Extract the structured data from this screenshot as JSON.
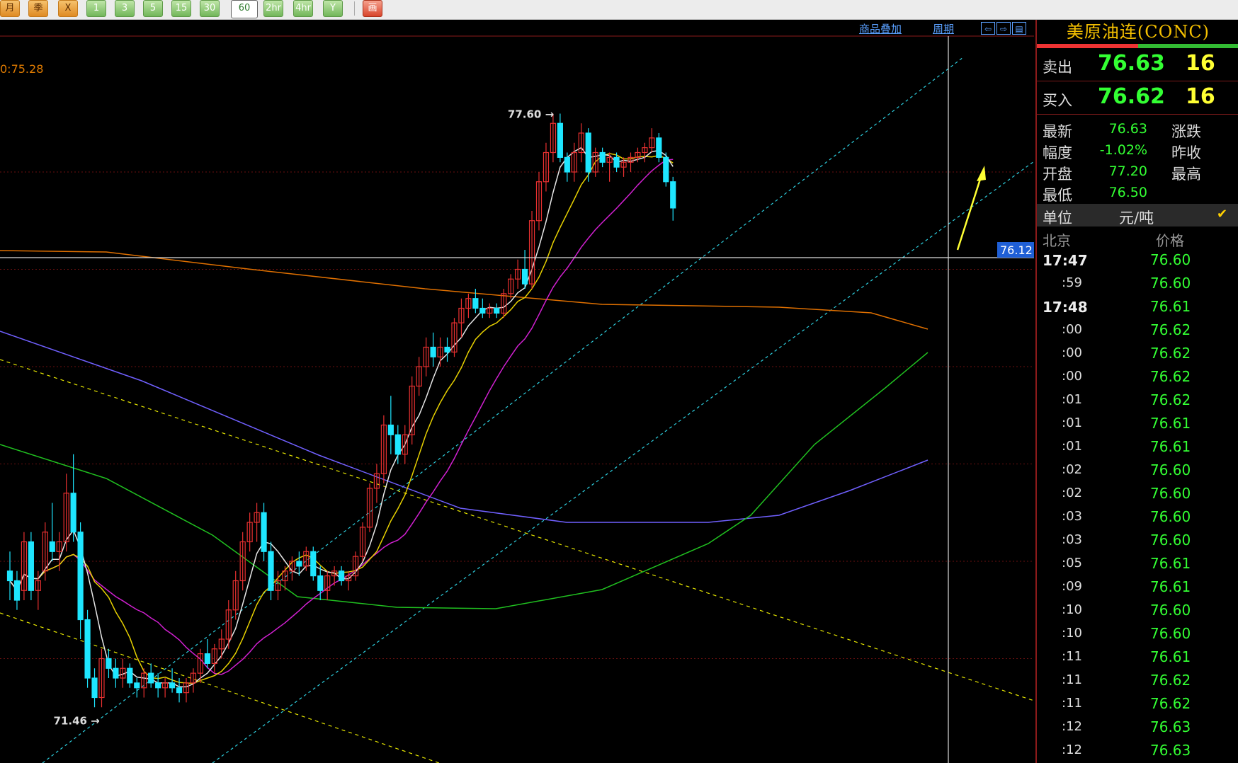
{
  "toolbar": {
    "buttons": [
      {
        "label": "月",
        "style": "orange"
      },
      {
        "label": "季",
        "style": "orange"
      },
      {
        "label": "X",
        "style": "orange"
      },
      {
        "label": "1",
        "style": "green"
      },
      {
        "label": "3",
        "style": "green"
      },
      {
        "label": "5",
        "style": "green"
      },
      {
        "label": "15",
        "style": "green"
      },
      {
        "label": "30",
        "style": "green"
      },
      {
        "label": "60",
        "style": "selected"
      },
      {
        "label": "2hr",
        "style": "green"
      },
      {
        "label": "4hr",
        "style": "green"
      },
      {
        "label": "Y",
        "style": "green"
      },
      {
        "label": "画",
        "style": "red"
      }
    ]
  },
  "chart_header": {
    "overlay_link": "商品叠加",
    "period_link": "周期",
    "ma_value": "0:75.28",
    "nav_icons": [
      "scroll-left-icon",
      "scroll-right-icon",
      "layout-icon"
    ]
  },
  "chart_data": {
    "type": "candlestick",
    "high_label": "77.60",
    "low_label": "71.46",
    "crosshair_price": "76.12",
    "colors": {
      "up": "#e83030",
      "down": "#1ee6ff",
      "ma5": "#e6e6e6",
      "ma10": "#e6d000",
      "ma20": "#d020d0",
      "ma60": "#20c020",
      "ma120": "#7060ff",
      "ma250": "#e07000",
      "channel": "#2ed0e0",
      "downtrend": "#e6e600",
      "arrow": "#ffff33"
    },
    "price_range": [
      71.0,
      78.2
    ],
    "candles": [
      [
        72.9,
        73.1,
        72.6,
        72.8
      ],
      [
        72.8,
        72.9,
        72.5,
        72.6
      ],
      [
        72.7,
        73.3,
        72.6,
        73.2
      ],
      [
        73.2,
        73.3,
        72.6,
        72.7
      ],
      [
        72.7,
        72.9,
        72.5,
        72.8
      ],
      [
        72.9,
        73.4,
        72.8,
        73.3
      ],
      [
        73.2,
        73.6,
        73.0,
        73.1
      ],
      [
        73.1,
        73.3,
        72.9,
        73.2
      ],
      [
        73.2,
        73.9,
        73.1,
        73.7
      ],
      [
        73.7,
        74.1,
        73.2,
        73.3
      ],
      [
        73.3,
        73.4,
        72.2,
        72.4
      ],
      [
        72.4,
        72.5,
        71.7,
        71.8
      ],
      [
        71.8,
        71.9,
        71.5,
        71.6
      ],
      [
        71.6,
        72.1,
        71.5,
        72.0
      ],
      [
        72.0,
        72.1,
        71.8,
        71.9
      ],
      [
        71.9,
        72.0,
        71.7,
        71.8
      ],
      [
        71.8,
        72.0,
        71.7,
        71.9
      ],
      [
        71.9,
        71.95,
        71.7,
        71.75
      ],
      [
        71.75,
        71.8,
        71.6,
        71.7
      ],
      [
        71.7,
        71.9,
        71.6,
        71.85
      ],
      [
        71.85,
        71.95,
        71.7,
        71.75
      ],
      [
        71.75,
        71.85,
        71.6,
        71.7
      ],
      [
        71.7,
        71.8,
        71.6,
        71.75
      ],
      [
        71.75,
        71.9,
        71.65,
        71.7
      ],
      [
        71.7,
        71.8,
        71.55,
        71.65
      ],
      [
        71.65,
        71.8,
        71.55,
        71.75
      ],
      [
        71.75,
        71.9,
        71.65,
        71.85
      ],
      [
        71.85,
        72.1,
        71.75,
        72.05
      ],
      [
        72.05,
        72.2,
        71.9,
        71.95
      ],
      [
        71.95,
        72.15,
        71.85,
        72.1
      ],
      [
        72.1,
        72.3,
        72.0,
        72.2
      ],
      [
        72.2,
        72.6,
        72.1,
        72.5
      ],
      [
        72.5,
        72.9,
        72.4,
        72.8
      ],
      [
        72.8,
        73.3,
        72.7,
        73.2
      ],
      [
        73.2,
        73.5,
        73.1,
        73.4
      ],
      [
        73.4,
        73.6,
        73.2,
        73.5
      ],
      [
        73.5,
        73.6,
        73.0,
        73.1
      ],
      [
        73.1,
        73.2,
        72.6,
        72.7
      ],
      [
        72.7,
        72.9,
        72.6,
        72.8
      ],
      [
        72.8,
        72.95,
        72.7,
        72.9
      ],
      [
        72.9,
        73.05,
        72.8,
        73.0
      ],
      [
        73.0,
        73.1,
        72.85,
        72.95
      ],
      [
        72.95,
        73.15,
        72.9,
        73.1
      ],
      [
        73.1,
        73.15,
        72.8,
        72.85
      ],
      [
        72.85,
        72.95,
        72.6,
        72.7
      ],
      [
        72.7,
        72.9,
        72.6,
        72.85
      ],
      [
        72.85,
        72.95,
        72.75,
        72.9
      ],
      [
        72.9,
        72.95,
        72.75,
        72.8
      ],
      [
        72.8,
        72.9,
        72.7,
        72.85
      ],
      [
        72.85,
        73.1,
        72.8,
        73.05
      ],
      [
        73.05,
        73.4,
        73.0,
        73.35
      ],
      [
        73.35,
        73.8,
        73.3,
        73.75
      ],
      [
        73.75,
        74.0,
        73.6,
        73.9
      ],
      [
        73.9,
        74.5,
        73.8,
        74.4
      ],
      [
        74.4,
        74.7,
        74.1,
        74.3
      ],
      [
        74.3,
        74.4,
        74.0,
        74.1
      ],
      [
        74.1,
        74.4,
        74.0,
        74.3
      ],
      [
        74.3,
        74.9,
        74.2,
        74.8
      ],
      [
        74.8,
        75.1,
        74.7,
        75.0
      ],
      [
        75.0,
        75.3,
        74.9,
        75.2
      ],
      [
        75.2,
        75.35,
        75.0,
        75.1
      ],
      [
        75.1,
        75.3,
        75.0,
        75.2
      ],
      [
        75.2,
        75.3,
        75.05,
        75.15
      ],
      [
        75.15,
        75.5,
        75.1,
        75.45
      ],
      [
        75.45,
        75.7,
        75.3,
        75.6
      ],
      [
        75.6,
        75.75,
        75.5,
        75.7
      ],
      [
        75.7,
        75.8,
        75.55,
        75.6
      ],
      [
        75.6,
        75.7,
        75.5,
        75.55
      ],
      [
        75.55,
        75.65,
        75.5,
        75.6
      ],
      [
        75.6,
        75.65,
        75.5,
        75.55
      ],
      [
        75.55,
        75.8,
        75.5,
        75.75
      ],
      [
        75.75,
        75.95,
        75.7,
        75.9
      ],
      [
        75.9,
        76.1,
        75.8,
        76.0
      ],
      [
        76.0,
        76.2,
        75.8,
        75.85
      ],
      [
        75.85,
        76.6,
        75.8,
        76.5
      ],
      [
        76.5,
        77.0,
        76.4,
        76.9
      ],
      [
        76.9,
        77.3,
        76.8,
        77.2
      ],
      [
        77.2,
        77.6,
        77.1,
        77.5
      ],
      [
        77.5,
        77.6,
        77.1,
        77.15
      ],
      [
        77.15,
        77.2,
        76.9,
        77.0
      ],
      [
        77.0,
        77.3,
        76.9,
        77.2
      ],
      [
        77.2,
        77.5,
        77.1,
        77.4
      ],
      [
        77.4,
        77.45,
        76.9,
        77.0
      ],
      [
        77.0,
        77.25,
        76.95,
        77.2
      ],
      [
        77.2,
        77.25,
        77.05,
        77.1
      ],
      [
        77.1,
        77.2,
        76.9,
        77.15
      ],
      [
        77.15,
        77.2,
        77.0,
        77.05
      ],
      [
        77.05,
        77.15,
        76.95,
        77.1
      ],
      [
        77.1,
        77.2,
        77.0,
        77.15
      ],
      [
        77.15,
        77.25,
        77.1,
        77.2
      ],
      [
        77.2,
        77.3,
        77.1,
        77.25
      ],
      [
        77.25,
        77.45,
        77.2,
        77.35
      ],
      [
        77.35,
        77.4,
        77.1,
        77.15
      ],
      [
        77.15,
        77.2,
        76.85,
        76.9
      ],
      [
        76.9,
        76.95,
        76.5,
        76.63
      ]
    ]
  },
  "panel": {
    "title": "美原油连(CONC)",
    "sell": {
      "label": "卖出",
      "price": "76.63",
      "volume": "16"
    },
    "buy": {
      "label": "买入",
      "price": "76.62",
      "volume": "16"
    },
    "info": [
      {
        "label": "最新",
        "value": "76.63",
        "label2": "涨跌"
      },
      {
        "label": "幅度",
        "value": "-1.02%",
        "label2": "昨收"
      },
      {
        "label": "开盘",
        "value": "77.20",
        "label2": "最高"
      },
      {
        "label": "最低",
        "value": "76.50",
        "label2": ""
      }
    ],
    "unit_label": "单位",
    "unit_value": "元/吨",
    "tick_header": {
      "time": "北京",
      "price": "价格"
    },
    "ticks": [
      {
        "time": "17:47",
        "price": "76.60",
        "main": true
      },
      {
        "time": ":59",
        "price": "76.60"
      },
      {
        "time": "17:48",
        "price": "76.61",
        "main": true
      },
      {
        "time": ":00",
        "price": "76.62"
      },
      {
        "time": ":00",
        "price": "76.62"
      },
      {
        "time": ":00",
        "price": "76.62"
      },
      {
        "time": ":01",
        "price": "76.62"
      },
      {
        "time": ":01",
        "price": "76.61"
      },
      {
        "time": ":01",
        "price": "76.61"
      },
      {
        "time": ":02",
        "price": "76.60"
      },
      {
        "time": ":02",
        "price": "76.60"
      },
      {
        "time": ":03",
        "price": "76.60"
      },
      {
        "time": ":03",
        "price": "76.60"
      },
      {
        "time": ":05",
        "price": "76.61"
      },
      {
        "time": ":09",
        "price": "76.61"
      },
      {
        "time": ":10",
        "price": "76.60"
      },
      {
        "time": ":10",
        "price": "76.60"
      },
      {
        "time": ":11",
        "price": "76.61"
      },
      {
        "time": ":11",
        "price": "76.62"
      },
      {
        "time": ":11",
        "price": "76.62"
      },
      {
        "time": ":12",
        "price": "76.63"
      },
      {
        "time": ":12",
        "price": "76.63"
      }
    ]
  }
}
